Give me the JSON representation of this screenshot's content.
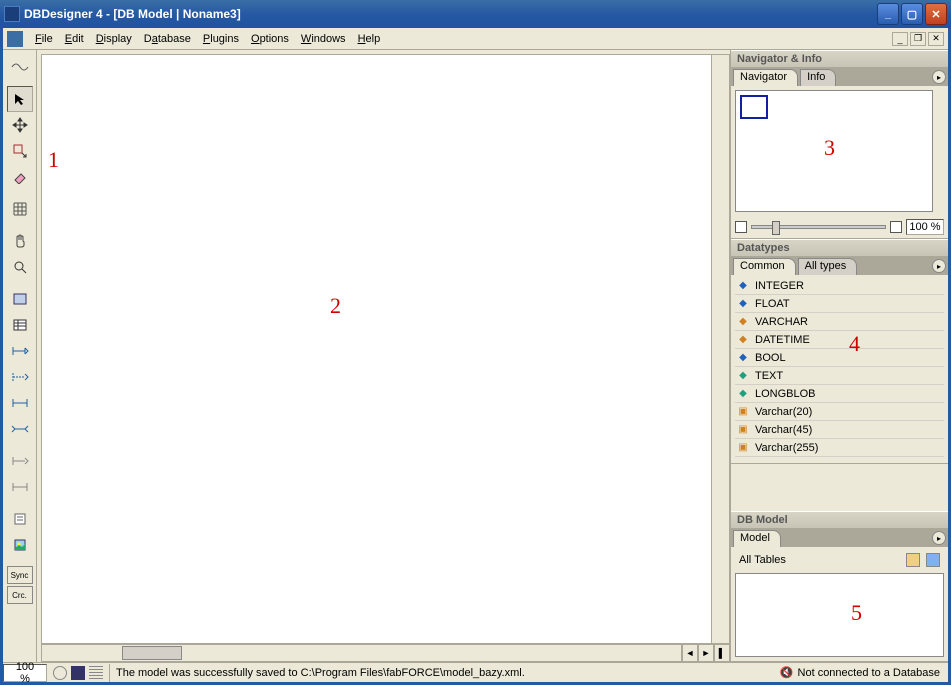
{
  "window": {
    "title": "DBDesigner 4 - [DB Model | Noname3]"
  },
  "menu": {
    "file": "File",
    "edit": "Edit",
    "display": "Display",
    "database": "Database",
    "plugins": "Plugins",
    "options": "Options",
    "windows": "Windows",
    "help": "Help"
  },
  "toolbox": {
    "sync": "Sync",
    "crc": "Crc."
  },
  "right": {
    "navigator": {
      "title": "Navigator & Info",
      "tab_navigator": "Navigator",
      "tab_info": "Info",
      "zoom_value": "100 %"
    },
    "datatypes": {
      "title": "Datatypes",
      "tab_common": "Common",
      "tab_all": "All types",
      "items": [
        "INTEGER",
        "FLOAT",
        "VARCHAR",
        "DATETIME",
        "BOOL",
        "TEXT",
        "LONGBLOB",
        "Varchar(20)",
        "Varchar(45)",
        "Varchar(255)"
      ]
    },
    "dbmodel": {
      "title": "DB Model",
      "tab_model": "Model",
      "all_tables": "All Tables"
    }
  },
  "status": {
    "zoom": "100 %",
    "message": "The model was successfully saved to C:\\Program Files\\fabFORCE\\model_bazy.xml.",
    "connection": "Not connected to a Database"
  },
  "annotations": {
    "a1": "1",
    "a2": "2",
    "a3": "3",
    "a4": "4",
    "a5": "5"
  }
}
